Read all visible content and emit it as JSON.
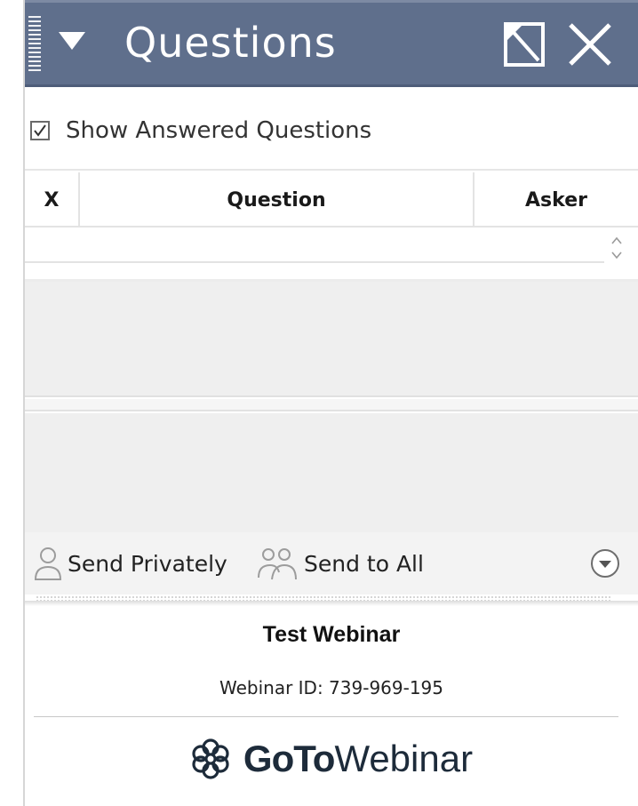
{
  "panel": {
    "title": "Questions",
    "icons": {
      "grip": "drag-grip-icon",
      "collapse": "collapse-triangle-icon",
      "undock": "undock-icon",
      "close": "close-icon"
    }
  },
  "filters": {
    "show_answered_label": "Show Answered Questions",
    "show_answered_checked": true
  },
  "table": {
    "columns": [
      "X",
      "Question",
      "Asker"
    ],
    "rows": []
  },
  "actions": {
    "send_privately_label": "Send Privately",
    "send_to_all_label": "Send to All"
  },
  "footer": {
    "webinar_title": "Test Webinar",
    "webinar_id": "Webinar ID: 739-969-195",
    "brand_bold": "GoTo",
    "brand_regular": "Webinar"
  },
  "colors": {
    "titlebar": "#5f6f8c",
    "pane_bg": "#efefef",
    "brand_blue": "#2c6ab0"
  }
}
